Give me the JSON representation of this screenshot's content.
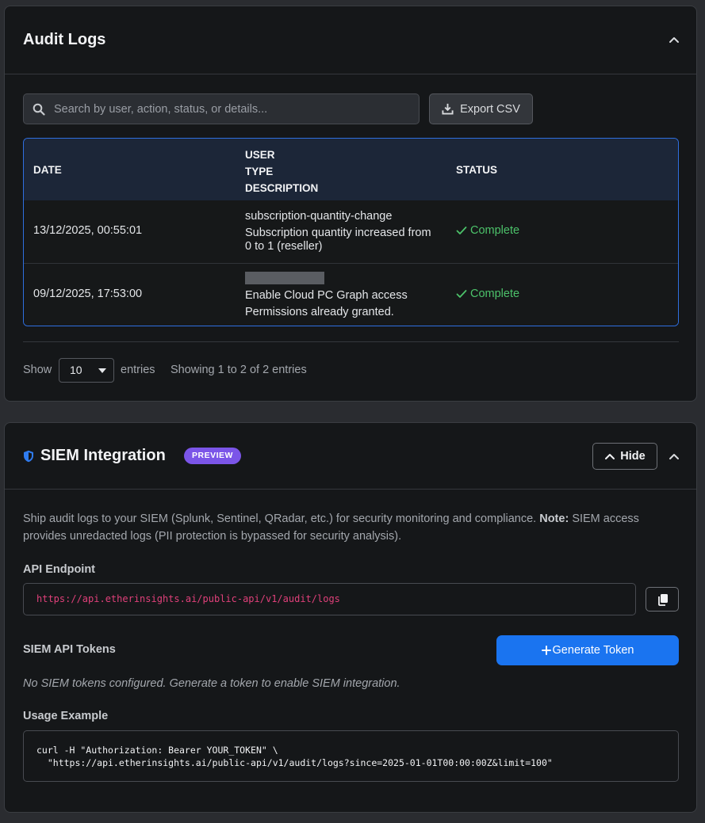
{
  "audit": {
    "title": "Audit Logs",
    "search_placeholder": "Search by user, action, status, or details...",
    "export_label": "Export CSV",
    "columns": {
      "date": "DATE",
      "user": "USER",
      "type": "TYPE",
      "description": "DESCRIPTION",
      "status": "STATUS"
    },
    "rows": [
      {
        "date": "13/12/2025, 00:55:01",
        "type": "subscription-quantity-change",
        "description": "Subscription quantity increased from 0 to 1 (reseller)",
        "status": "Complete"
      },
      {
        "date": "09/12/2025, 17:53:00",
        "type": "Enable Cloud PC Graph access",
        "description": "Permissions already granted.",
        "status": "Complete"
      }
    ],
    "show_label": "Show",
    "entries_value": "10",
    "entries_label": "entries",
    "showing_info": "Showing 1 to 2 of 2 entries"
  },
  "siem": {
    "title": "SIEM Integration",
    "badge": "PREVIEW",
    "hide_label": "Hide",
    "description": "Ship audit logs to your SIEM (Splunk, Sentinel, QRadar, etc.) for security monitoring and compliance.",
    "note_label": "Note:",
    "note_text": "SIEM access provides unredacted logs (PII protection is bypassed for security analysis).",
    "endpoint_label": "API Endpoint",
    "endpoint_url": "https://api.etherinsights.ai/public-api/v1/audit/logs",
    "tokens_label": "SIEM API Tokens",
    "generate_label": "Generate Token",
    "no_tokens": "No SIEM tokens configured. Generate a token to enable SIEM integration.",
    "usage_label": "Usage Example",
    "usage_code": "curl -H \"Authorization: Bearer YOUR_TOKEN\" \\\n  \"https://api.etherinsights.ai/public-api/v1/audit/logs?since=2025-01-01T00:00:00Z&limit=100\""
  },
  "colors": {
    "accent_blue": "#1a74f0",
    "status_green": "#4cc26a",
    "badge_purple": "#7b55e8",
    "endpoint_pink": "#e0407a"
  }
}
